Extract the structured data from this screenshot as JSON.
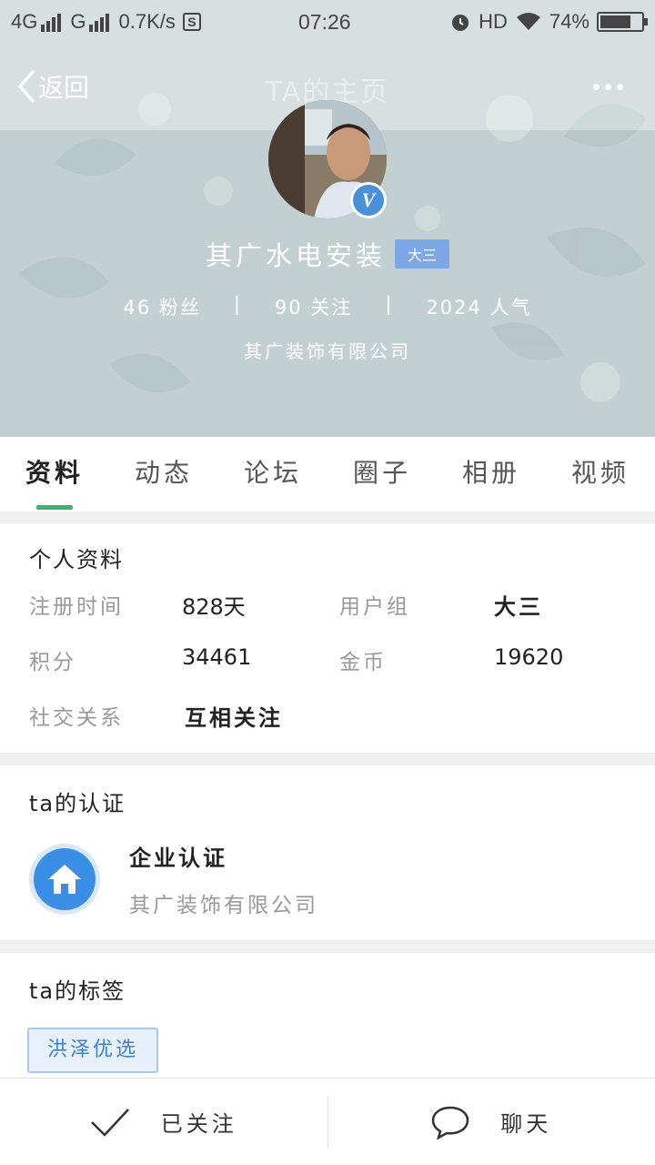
{
  "status_bar": {
    "net1": "4G",
    "net2": "G",
    "speed": "0.7K/s",
    "time": "07:26",
    "hd": "HD",
    "battery": "74%",
    "battery_level": 0.74
  },
  "header": {
    "back_label": "返回",
    "title": "TA的主页"
  },
  "profile": {
    "name": "其广水电安装",
    "rank_badge": "大三",
    "verified_mark": "V",
    "fans": "46 粉丝",
    "follows": "90 关注",
    "popularity": "2024 人气",
    "separator": "|",
    "company": "其广装饰有限公司"
  },
  "tabs": [
    {
      "label": "资料",
      "active": true
    },
    {
      "label": "动态",
      "active": false
    },
    {
      "label": "论坛",
      "active": false
    },
    {
      "label": "圈子",
      "active": false
    },
    {
      "label": "相册",
      "active": false
    },
    {
      "label": "视频",
      "active": false
    }
  ],
  "personal": {
    "title": "个人资料",
    "reg_time_label": "注册时间",
    "reg_time_value": "828天",
    "group_label": "用户组",
    "group_value": "大三",
    "points_label": "积分",
    "points_value": "34461",
    "coins_label": "金币",
    "coins_value": "19620",
    "social_label": "社交关系",
    "social_value": "互相关注"
  },
  "certification": {
    "title": "ta的认证",
    "type": "企业认证",
    "company": "其广装饰有限公司",
    "icon": "home-icon"
  },
  "tags": {
    "title": "ta的标签",
    "items": [
      "洪泽优选"
    ]
  },
  "bottom_bar": {
    "followed_label": "已关注",
    "chat_label": "聊天"
  },
  "colors": {
    "accent_green": "#3cb371",
    "badge_blue": "#7ea7e6",
    "cert_blue": "#3a8ee6"
  }
}
